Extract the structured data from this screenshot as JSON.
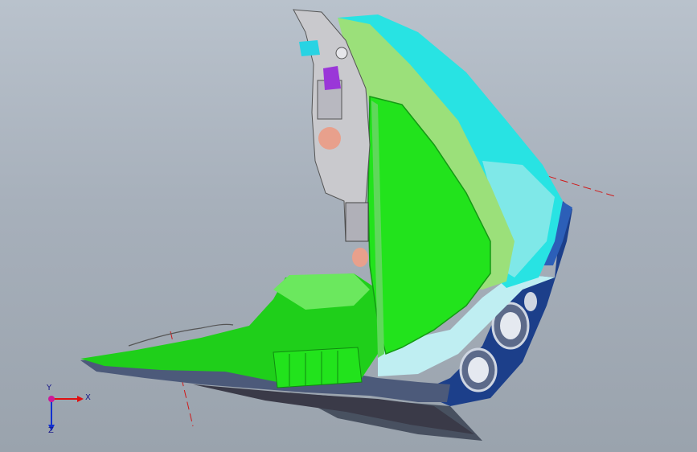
{
  "triad": {
    "x_label": "X",
    "y_label": "Y",
    "z_label": "Z",
    "colors": {
      "x": "#e01010",
      "y": "#10a010",
      "z": "#1030d0",
      "origin": "#cc1a9a"
    }
  },
  "model": {
    "palette": {
      "bright_green": "#22e31c",
      "light_green": "#9be07a",
      "cyan": "#28e3e3",
      "light_cyan": "#bfeef2",
      "dark_blue": "#1c3f8a",
      "slate": "#4c5a7a",
      "gray": "#c9c9cd",
      "purple": "#9a36d8",
      "skin": "#e8a08c",
      "dark_gray": "#3a3a48"
    }
  }
}
